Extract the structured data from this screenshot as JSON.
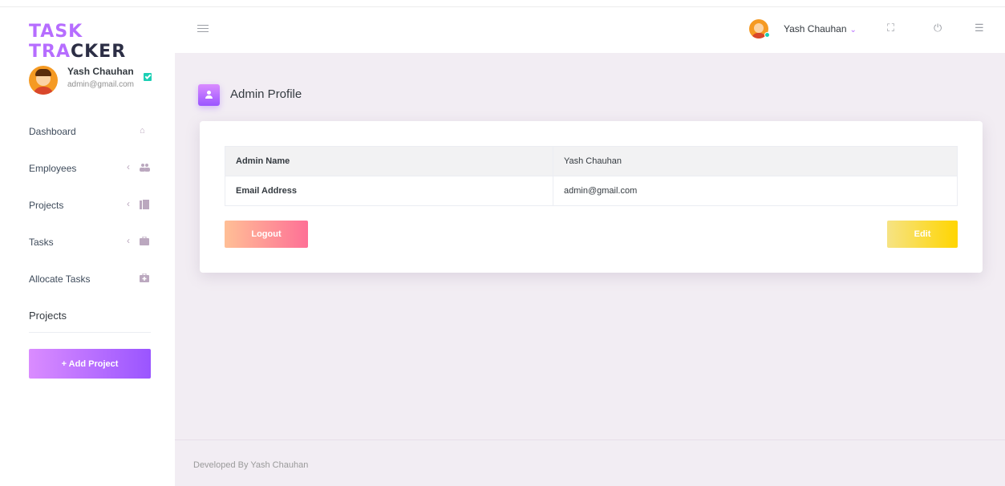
{
  "brand": {
    "part1": "TASK TRA",
    "part2": "CKER"
  },
  "sidebar": {
    "user": {
      "name": "Yash Chauhan",
      "email": "admin@gmail.com"
    },
    "items": [
      {
        "label": "Dashboard",
        "icon": "home-icon",
        "glyph": "⌂",
        "has_chevron": false
      },
      {
        "label": "Employees",
        "icon": "users-icon",
        "glyph": "👥",
        "has_chevron": true
      },
      {
        "label": "Projects",
        "icon": "folder-icon",
        "glyph": "▥",
        "has_chevron": true
      },
      {
        "label": "Tasks",
        "icon": "briefcase-icon",
        "glyph": "▬",
        "has_chevron": true
      },
      {
        "label": "Allocate Tasks",
        "icon": "briefcase-plus-icon",
        "glyph": "▣",
        "has_chevron": false
      }
    ],
    "chevron": "‹",
    "section_title": "Projects",
    "add_project_label": "+ Add Project"
  },
  "navbar": {
    "user_name": "Yash Chauhan",
    "caret": "⌄",
    "fullscreen_glyph": "⛶",
    "power_glyph": "⏻",
    "list_glyph": "☰"
  },
  "page": {
    "title": "Admin Profile",
    "table": [
      {
        "key": "Admin Name",
        "value": "Yash Chauhan"
      },
      {
        "key": "Email Address",
        "value": "admin@gmail.com"
      }
    ],
    "logout_label": "Logout",
    "edit_label": "Edit"
  },
  "footer": {
    "text": "Developed By Yash Chauhan"
  },
  "colors": {
    "accent": "#b66dff",
    "background": "#f2edf3",
    "success": "#1bcfb4"
  }
}
